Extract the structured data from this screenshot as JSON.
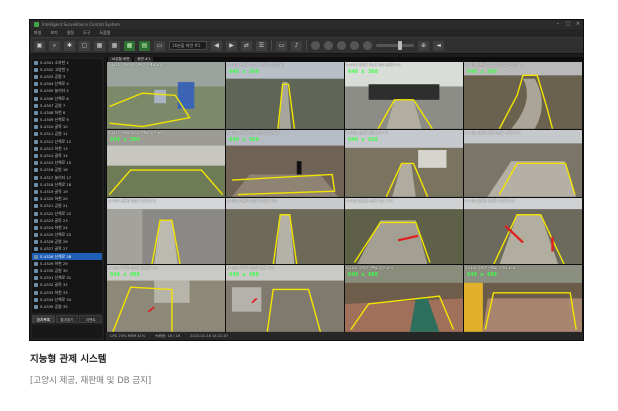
{
  "window": {
    "title": "Intelligent Surveillance Control System",
    "min_icon": "minimize-icon",
    "max_icon": "maximize-icon",
    "close_icon": "close-icon",
    "min_glyph": "–",
    "max_glyph": "□",
    "close_glyph": "×"
  },
  "menu": [
    "파일",
    "보기",
    "설정",
    "도구",
    "도움말"
  ],
  "toolbar": {
    "layout_select": "16분할 화면 #1",
    "prev_glyph": "◀",
    "next_glyph": "▶"
  },
  "sidebar": {
    "items": [
      "S-4301 소하천 1",
      "S-4302 고양천 2",
      "S-4303 공원 3",
      "S-4304 산책로 4",
      "S-4305 놀이터 5",
      "S-4306 산책로 6",
      "S-4307 공원 7",
      "S-4308 하천 8",
      "S-4309 산책로 9",
      "S-4310 골목 10",
      "S-4311 공원 11",
      "S-4312 산책로 12",
      "S-4313 하천 13",
      "S-4314 골목 14",
      "S-4315 산책로 15",
      "S-4316 공원 16",
      "S-4317 놀이터 17",
      "S-4318 산책로 18",
      "S-4319 골목 19",
      "S-4320 하천 20",
      "S-4321 공원 21",
      "S-4322 산책로 22",
      "S-4323 골목 23",
      "S-4324 하천 24",
      "S-4325 산책로 25",
      "S-4326 공원 26",
      "S-4327 골목 27",
      "S-4328 산책로 28",
      "S-4329 하천 29",
      "S-4330 공원 30",
      "S-4331 산책로 31",
      "S-4332 골목 32",
      "S-4333 하천 33",
      "S-4334 산책로 34",
      "S-4335 공원 35"
    ],
    "selected_index": 27,
    "tabs": [
      "장치목록",
      "즐겨찾기",
      "이벤트"
    ]
  },
  "grid": {
    "tabs": [
      "16분할 화면",
      "화면 #1"
    ],
    "cameras": [
      {
        "label": "S-4453 인테리어 12층 앞 산책로 #1",
        "res": "",
        "scene": "playground"
      },
      {
        "label": "S-4454 산책로 제2교 진입로 사거리 #2",
        "res": "640 x 360",
        "scene": "path"
      },
      {
        "label": "S-4455 산책로 제3교 하부 산책로 #3",
        "res": "640 x 360",
        "scene": "tunnel"
      },
      {
        "label": "S-4456 산책로 제4교 진입로 사거리 #4",
        "res": "640 x 360",
        "scene": "curve"
      },
      {
        "label": "S-4457 산책로 제5교 산책로 입구 #5",
        "res": "640 x 360",
        "scene": "wall"
      },
      {
        "label": "S-4458 산책로 공원 진입로 입구 #6",
        "res": "640 x 360",
        "scene": "person"
      },
      {
        "label": "S-4459 산책로 공원 입구 #7",
        "res": "640 x 360",
        "scene": "houses"
      },
      {
        "label": "S-4460 산책로 공원 진입로 사거리 #8",
        "res": "",
        "scene": "stairs"
      },
      {
        "label": "S-4461 골목길 연결로 사거리 #9",
        "res": "",
        "scene": "alley"
      },
      {
        "label": "S-4462 골목길 연결로 산책로 #10",
        "res": "",
        "scene": "path2"
      },
      {
        "label": "S-4463 골목길 산책로 입구 #11",
        "res": "",
        "scene": "red1"
      },
      {
        "label": "S-4464 골목길 산책로 사거리 #12",
        "res": "",
        "scene": "red2"
      },
      {
        "label": "S-4465 주택가 연결로 산책로 #13",
        "res": "640 x 480",
        "scene": "lot"
      },
      {
        "label": "S-4466 주택가 연결로 골목 #14",
        "res": "640 x 480",
        "scene": "lot2"
      },
      {
        "label": "S-4467 주택가 산책로 입구 #15",
        "res": "640 x 480",
        "scene": "brick"
      },
      {
        "label": "S-4468 주택가 산책로 사거리 #16",
        "res": "640 x 480",
        "scene": "brick2"
      }
    ]
  },
  "status": {
    "left": "CPU 23%  MEM 41%",
    "mid": "녹화중: 16 / 16",
    "right": "2023-01-18 14:22:07"
  },
  "caption": {
    "title": "지능형 관제 시스템",
    "source": "[고양시 제공, 재판매 및 DB 금지]"
  },
  "colors": {
    "detection_zone": "#f2e400",
    "resolution_text": "#3cff47",
    "alert": "#e02020",
    "selection": "#1f5fb8"
  }
}
